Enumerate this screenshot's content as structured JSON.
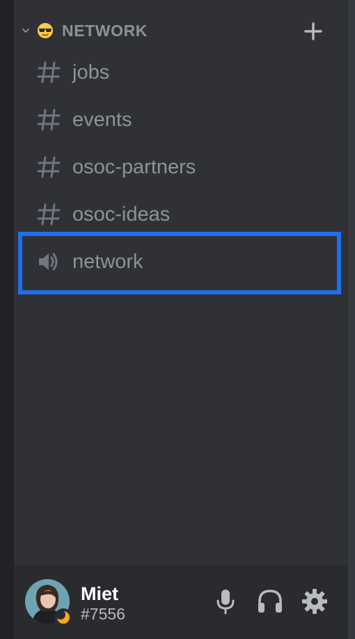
{
  "category": {
    "emoji": "sunglasses-emoji",
    "label": "NETWORK",
    "add_icon": "plus-icon",
    "collapse_icon": "chevron-down-icon"
  },
  "channels": [
    {
      "label": "jobs",
      "type": "text",
      "icon": "hashtag-icon"
    },
    {
      "label": "events",
      "type": "text",
      "icon": "hashtag-icon"
    },
    {
      "label": "osoc-partners",
      "type": "text",
      "icon": "hashtag-icon"
    },
    {
      "label": "osoc-ideas",
      "type": "text",
      "icon": "hashtag-icon"
    },
    {
      "label": "network",
      "type": "voice",
      "icon": "speaker-icon",
      "highlighted": true
    }
  ],
  "user": {
    "name": "Miet",
    "discriminator": "#7556",
    "status": "idle",
    "mic_icon": "microphone-icon",
    "headset_icon": "headphones-icon",
    "settings_icon": "gear-icon"
  },
  "colors": {
    "sidebar_bg": "#2f3136",
    "panel_bg": "#292b2f",
    "muted_text": "#8e9297",
    "highlight_border": "#1f6fef",
    "idle_status": "#faa81a"
  }
}
